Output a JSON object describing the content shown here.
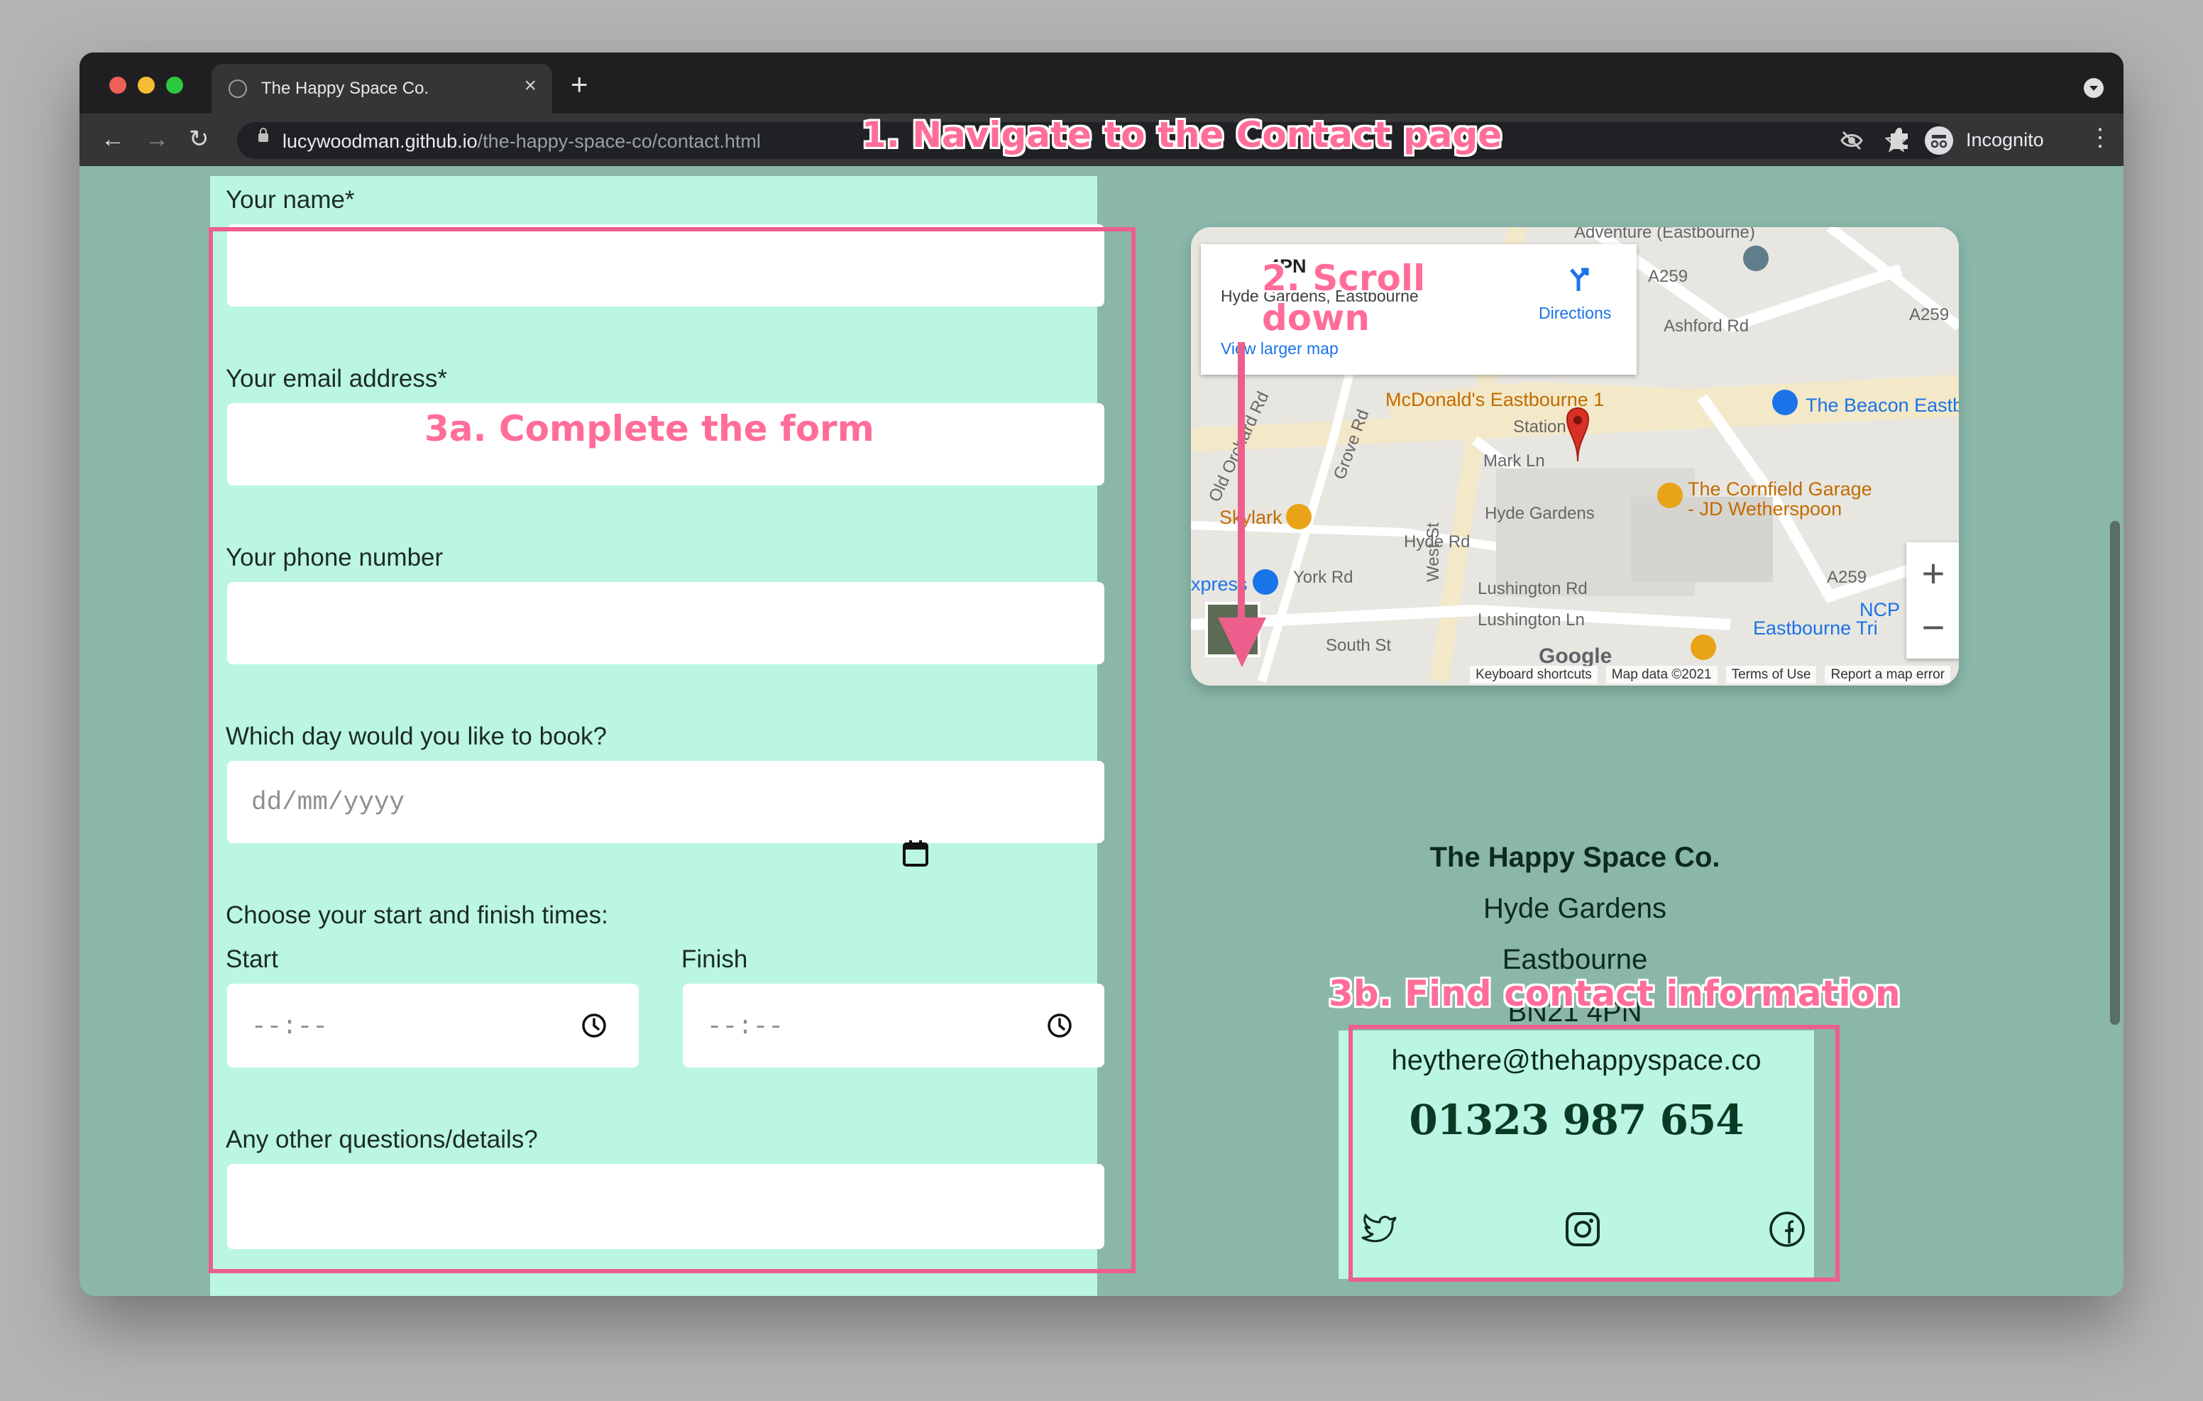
{
  "browser": {
    "tab_title": "The Happy Space Co.",
    "tab_close": "×",
    "new_tab": "+",
    "url_domain": "lucywoodman.github.io",
    "url_path": "/the-happy-space-co/contact.html",
    "incognito_label": "Incognito",
    "back": "←",
    "forward": "→",
    "reload": "↻",
    "more": "⋮"
  },
  "form": {
    "name_label": "Your name*",
    "email_label": "Your email address*",
    "phone_label": "Your phone number",
    "day_label": "Which day would you like to book?",
    "date_placeholder": "dd/mm/yyyy",
    "times_label": "Choose your start and finish times:",
    "start_label": "Start",
    "finish_label": "Finish",
    "time_placeholder": "--:--",
    "other_label": "Any other questions/details?"
  },
  "map": {
    "card_title": "4PN",
    "card_subtitle": "Hyde Gardens, Eastbourne",
    "directions": "Directions",
    "view_larger": "View larger map",
    "labels": {
      "adventure": "Adventure (Eastbourne)",
      "mcdonalds": "McDonald's Eastbourne 1",
      "beacon": "The Beacon Eastb",
      "cornfield1": "The Cornfield Garage",
      "cornfield2": "- JD Wetherspoon",
      "skylark": "Skylark",
      "express": "xpress",
      "ncp": "NCP",
      "trin": "Eastbourne Tri",
      "a259a": "A259",
      "a259b": "A259",
      "a259c": "A259",
      "ashford": "Ashford Rd",
      "hyde_gardens": "Hyde Gardens",
      "mark_ln": "Mark Ln",
      "station": "Station",
      "york_rd": "York Rd",
      "hyde_rd": "Hyde Rd",
      "lushington_rd": "Lushington Rd",
      "lushington_ln": "Lushington Ln",
      "south_st": "South St",
      "west_st": "West St",
      "grove_rd": "Grove Rd",
      "old_orchard": "Old Orchard Rd"
    },
    "zoom_in": "+",
    "zoom_out": "−",
    "google": "Google",
    "keyboard": "Keyboard shortcuts",
    "map_data": "Map data ©2021",
    "terms": "Terms of Use",
    "report": "Report a map error"
  },
  "business": {
    "name": "The Happy Space Co.",
    "street": "Hyde Gardens",
    "town": "Eastbourne",
    "postcode": "BN21 4PN",
    "email": "heythere@thehappyspace.co",
    "phone": "01323 987 654"
  },
  "annotations": {
    "step1": "1. Navigate to the Contact page",
    "step2_line1": "2. Scroll",
    "step2_line2": "down",
    "step3a": "3a. Complete the form",
    "step3b": "3b. Find contact information"
  },
  "colors": {
    "page_bg": "#8ab7a9",
    "form_bg": "#bbf5e4",
    "annotation": "#ec5f8c",
    "text_dark": "#0d2a22"
  }
}
